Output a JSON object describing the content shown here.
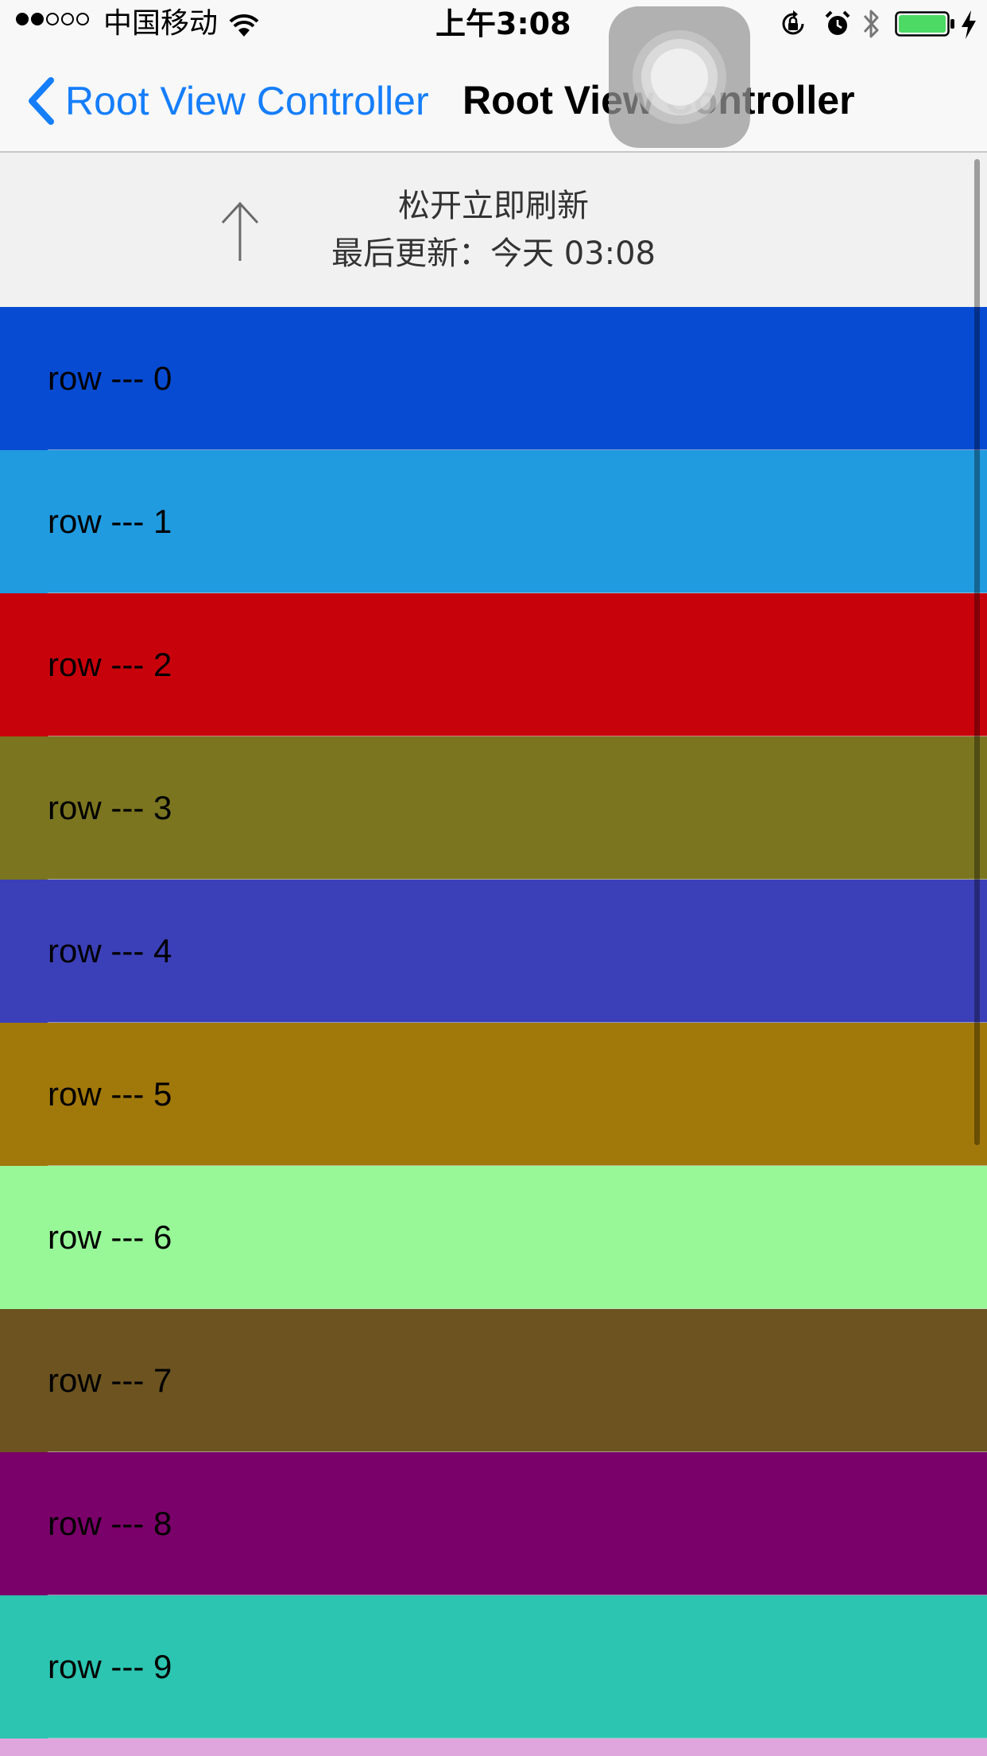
{
  "status_bar": {
    "signal_dots": [
      true,
      true,
      false,
      false,
      false
    ],
    "carrier": "中国移动",
    "time": "上午3:08",
    "icons": [
      "wifi-icon",
      "orientation-lock-icon",
      "alarm-icon",
      "bluetooth-icon",
      "battery-icon",
      "charging-icon"
    ],
    "battery_level": 1.0,
    "battery_color": "#4cd964"
  },
  "nav_bar": {
    "back_label": "Root View Controller",
    "title": "Root View Controller",
    "tint_color": "#157efb"
  },
  "refresh_header": {
    "state_text": "松开立即刷新",
    "last_updated": "最后更新：今天 03:08",
    "arrow_icon": "arrow-up-icon"
  },
  "rows": [
    {
      "label": "row --- 0",
      "color": "#074bd3"
    },
    {
      "label": "row --- 1",
      "color": "#209be0"
    },
    {
      "label": "row --- 2",
      "color": "#c8020b"
    },
    {
      "label": "row --- 3",
      "color": "#7b7520"
    },
    {
      "label": "row --- 4",
      "color": "#3b40b8"
    },
    {
      "label": "row --- 5",
      "color": "#a1780a"
    },
    {
      "label": "row --- 6",
      "color": "#98f898"
    },
    {
      "label": "row --- 7",
      "color": "#6c5320"
    },
    {
      "label": "row --- 8",
      "color": "#7a006a"
    },
    {
      "label": "row --- 9",
      "color": "#2cc5b1"
    },
    {
      "label": "",
      "color": "#dfa6de"
    }
  ]
}
